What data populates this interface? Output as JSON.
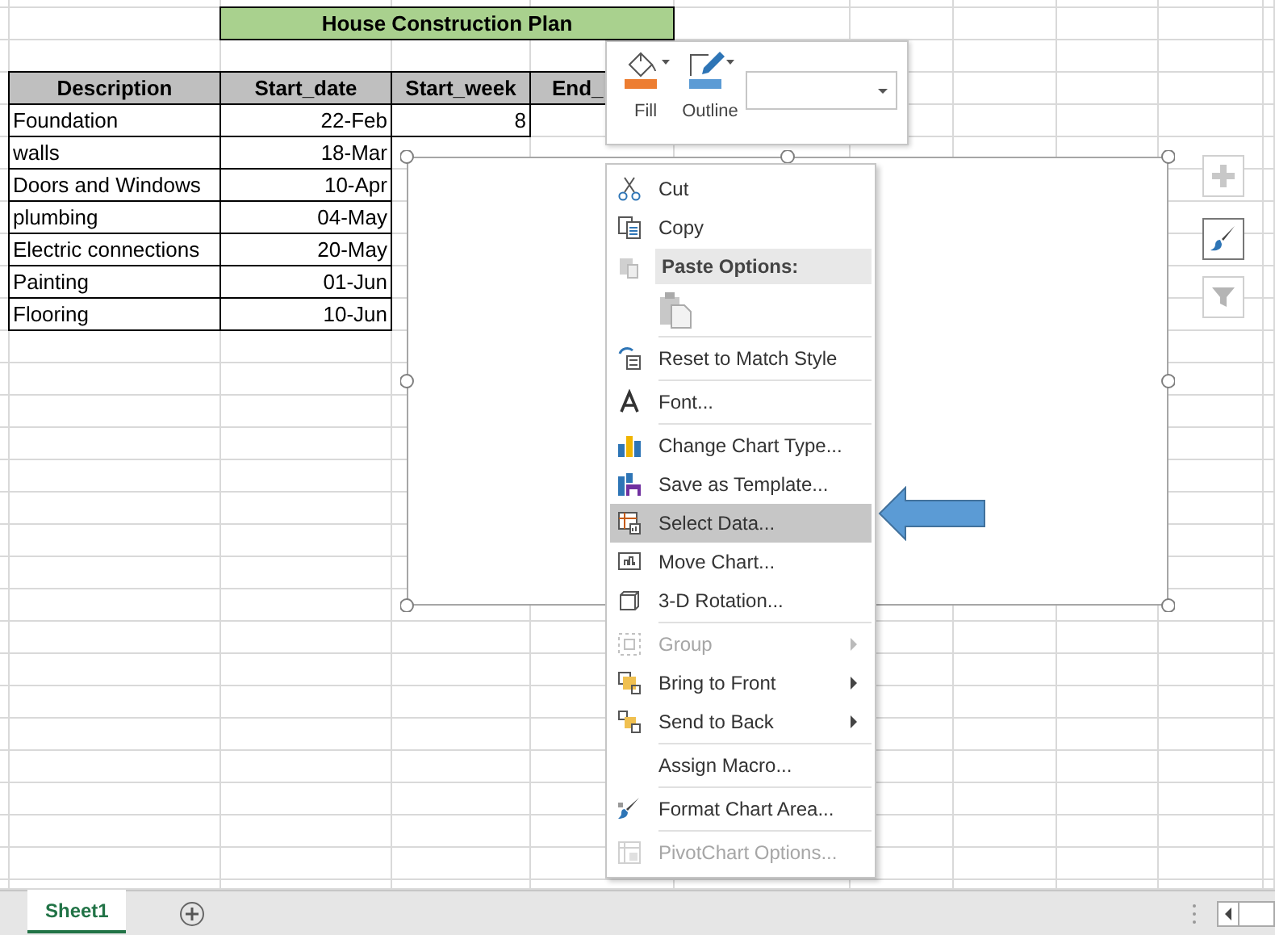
{
  "spreadsheet": {
    "title": "House Construction Plan",
    "columns": [
      "Description",
      "Start_date",
      "Start_week",
      "End_"
    ],
    "rows": [
      {
        "cells": [
          "Foundation",
          "22-Feb",
          "8"
        ]
      },
      {
        "cells": [
          "walls",
          "18-Mar"
        ]
      },
      {
        "cells": [
          "Doors and Windows",
          "10-Apr"
        ]
      },
      {
        "cells": [
          "plumbing",
          "04-May"
        ]
      },
      {
        "cells": [
          "Electric connections",
          "20-May"
        ]
      },
      {
        "cells": [
          "Painting",
          "01-Jun"
        ]
      },
      {
        "cells": [
          "Flooring",
          "10-Jun"
        ]
      }
    ]
  },
  "mini_toolbar": {
    "buttons": [
      {
        "label": "Fill"
      },
      {
        "label": "Outline"
      }
    ]
  },
  "context_menu": [
    {
      "kind": "item",
      "label": "Cut",
      "disabled": false,
      "selected": false,
      "submenu": false,
      "separator_after": false
    },
    {
      "kind": "item",
      "label": "Copy",
      "disabled": false,
      "selected": false,
      "submenu": false,
      "separator_after": false
    },
    {
      "kind": "header",
      "label": "Paste Options:"
    },
    {
      "kind": "paste_icons",
      "separator_after": true
    },
    {
      "kind": "item",
      "label": "Reset to Match Style",
      "disabled": false,
      "selected": false,
      "submenu": false,
      "separator_after": true
    },
    {
      "kind": "item",
      "label": "Font...",
      "disabled": false,
      "selected": false,
      "submenu": false,
      "separator_after": true
    },
    {
      "kind": "item",
      "label": "Change Chart Type...",
      "disabled": false,
      "selected": false,
      "submenu": false,
      "separator_after": false
    },
    {
      "kind": "item",
      "label": "Save as Template...",
      "disabled": false,
      "selected": false,
      "submenu": false,
      "separator_after": false
    },
    {
      "kind": "item",
      "label": "Select Data...",
      "disabled": false,
      "selected": true,
      "submenu": false,
      "separator_after": false
    },
    {
      "kind": "item",
      "label": "Move Chart...",
      "disabled": false,
      "selected": false,
      "submenu": false,
      "separator_after": false
    },
    {
      "kind": "item",
      "label": "3-D Rotation...",
      "disabled": false,
      "selected": false,
      "submenu": false,
      "separator_after": true
    },
    {
      "kind": "item",
      "label": "Group",
      "disabled": true,
      "selected": false,
      "submenu": true,
      "separator_after": false
    },
    {
      "kind": "item",
      "label": "Bring to Front",
      "disabled": false,
      "selected": false,
      "submenu": true,
      "separator_after": false
    },
    {
      "kind": "item",
      "label": "Send to Back",
      "disabled": false,
      "selected": false,
      "submenu": true,
      "separator_after": true
    },
    {
      "kind": "item",
      "label": "Assign Macro...",
      "disabled": false,
      "selected": false,
      "submenu": false,
      "separator_after": true
    },
    {
      "kind": "item",
      "label": "Format Chart Area...",
      "disabled": false,
      "selected": false,
      "submenu": false,
      "separator_after": true
    },
    {
      "kind": "item",
      "label": "PivotChart Options...",
      "disabled": true,
      "selected": false,
      "submenu": false,
      "separator_after": false
    }
  ],
  "sheet_tabs": [
    {
      "label": "Sheet1",
      "selected": true
    }
  ]
}
